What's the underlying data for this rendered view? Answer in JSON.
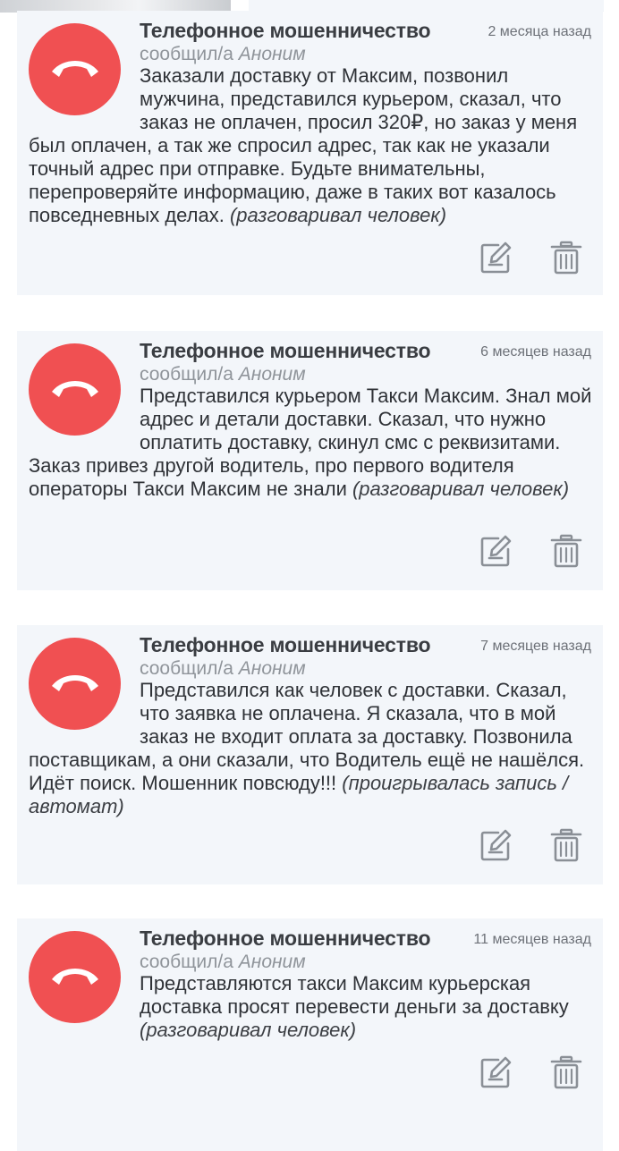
{
  "reports": [
    {
      "category": "Телефонное мошенничество",
      "time_ago": "2 месяца назад",
      "reported_by_prefix": "сообщил/а",
      "reporter": "Аноним",
      "text": "Заказали доставку от Максим, позвонил мужчина, представился курьером, сказал, что заказ не оплачен, просил 320₽, но заказ у меня был оплачен, а так же спросил адрес, так как не указали точный адрес при отправке. Будьте внимательны, перепроверяйте информацию, даже в таких вот казалось повседневных делах.",
      "call_type": "(разговаривал человек)"
    },
    {
      "category": "Телефонное мошенничество",
      "time_ago": "6 месяцев назад",
      "reported_by_prefix": "сообщил/а",
      "reporter": "Аноним",
      "text": "Представился курьером Такси Максим. Знал мой адрес и детали доставки. Сказал, что нужно оплатить доставку, скинул смс с реквизитами. Заказ привез другой водитель, про первого водителя операторы Такси Максим не знали",
      "call_type": "(разговаривал человек)"
    },
    {
      "category": "Телефонное мошенничество",
      "time_ago": "7 месяцев назад",
      "reported_by_prefix": "сообщил/а",
      "reporter": "Аноним",
      "text": "Представился как человек с доставки. Сказал, что заявка не оплачена. Я сказала, что в мой заказ не входит оплата за доставку. Позвонила поставщикам, а они сказали, что Водитель ещё не нашёлся. Идёт поиск. Мошенник повсюду!!!",
      "call_type": "(проигрывалась запись / автомат)"
    },
    {
      "category": "Телефонное мошенничество",
      "time_ago": "11 месяцев назад",
      "reported_by_prefix": "сообщил/а",
      "reporter": "Аноним",
      "text": "Представляются такси Максим курьерская доставка просят перевести деньги за доставку",
      "call_type": "(разговаривал человек)"
    }
  ],
  "icons": {
    "avatar": "phone-hangup-icon",
    "edit": "edit-icon",
    "delete": "trash-icon"
  },
  "colors": {
    "avatar_bg": "#f05052",
    "card_bg": "#f3f6fa",
    "title": "#3a3d42",
    "muted": "#8f949a",
    "icon": "#8a8f96"
  }
}
